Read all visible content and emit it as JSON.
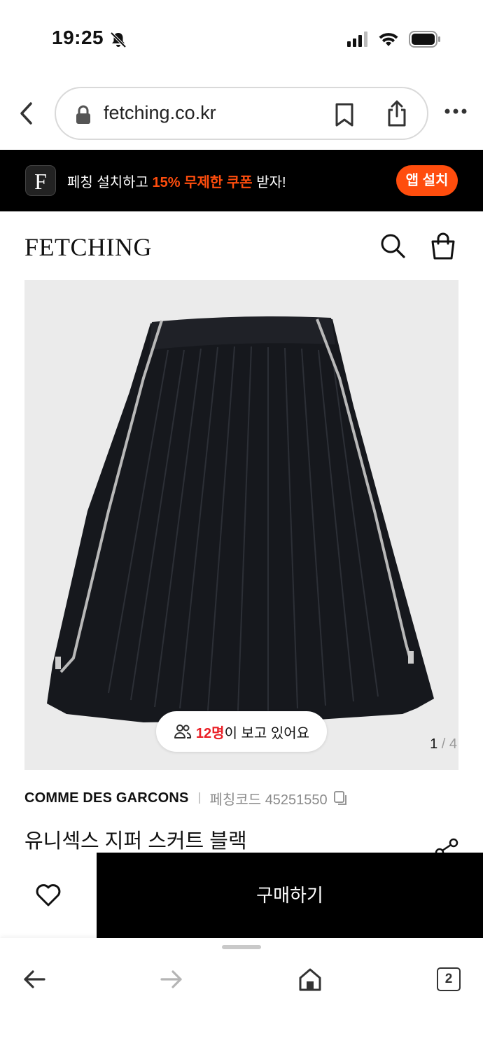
{
  "status_bar": {
    "time": "19:25"
  },
  "browser": {
    "url": "fetching.co.kr",
    "tab_count": "2"
  },
  "app_banner": {
    "logo_letter": "F",
    "text_before": "페칭 설치하고 ",
    "highlight": "15% 무제한 쿠폰",
    "text_after": " 받자!",
    "install_label": "앱 설치",
    "accent_color": "#ff4d0d"
  },
  "site": {
    "logo": "FETCHING"
  },
  "product": {
    "viewers_count": "12명",
    "viewers_suffix": "이 보고 있어요",
    "image_current": "1",
    "image_separator": "/",
    "image_total": "4",
    "brand": "COMME DES GARCONS",
    "code_label": "페칭코드 45251550",
    "title": "유니섹스 지퍼 스커트 블랙"
  },
  "purchase": {
    "buy_label": "구매하기"
  },
  "icons": [
    "bell-slash-icon",
    "signal-icon",
    "wifi-icon",
    "battery-icon",
    "chevron-left-icon",
    "lock-icon",
    "bookmark-icon",
    "share-icon",
    "more-icon",
    "search-icon",
    "shopping-bag-icon",
    "people-icon",
    "copy-icon",
    "heart-icon",
    "arrow-left-icon",
    "arrow-right-icon",
    "home-icon",
    "tabs-icon"
  ]
}
